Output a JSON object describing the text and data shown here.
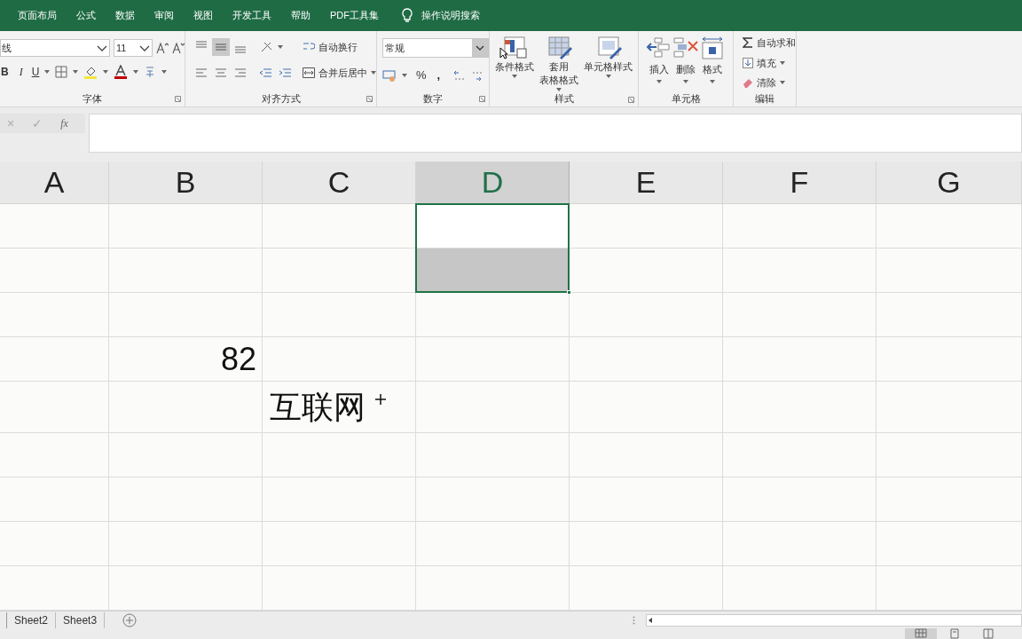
{
  "menu_tabs": [
    {
      "label": "页面布局",
      "selected": false
    },
    {
      "label": "公式",
      "selected": false
    },
    {
      "label": "数据",
      "selected": false
    },
    {
      "label": "审阅",
      "selected": false
    },
    {
      "label": "视图",
      "selected": false
    },
    {
      "label": "开发工具",
      "selected": false
    },
    {
      "label": "帮助",
      "selected": false
    },
    {
      "label": "PDF工具集",
      "selected": false
    }
  ],
  "tell_me": "操作说明搜索",
  "font_group": {
    "font_name": "线",
    "font_size": "11",
    "bold": "B",
    "italic": "I",
    "underline": "U",
    "label": "字体"
  },
  "align_group": {
    "wrap_text": "自动换行",
    "merge_center": "合并后居中",
    "label": "对齐方式"
  },
  "number_group": {
    "format": "常规",
    "percent": "%",
    "comma": ",",
    "label": "数字"
  },
  "styles_group": {
    "buttons": [
      {
        "lines": [
          "条件格式"
        ]
      },
      {
        "lines": [
          "套用",
          "表格格式"
        ]
      },
      {
        "lines": [
          "单元格样式"
        ]
      }
    ],
    "label": "样式"
  },
  "cells_group": {
    "buttons": [
      "插入",
      "删除",
      "格式"
    ],
    "label": "单元格"
  },
  "editing_group": {
    "autosum": "自动求和",
    "fill": "填充",
    "clear": "清除",
    "label": "编辑"
  },
  "formula_bar": {
    "cancel": "×",
    "enter": "✓",
    "fx": "fx"
  },
  "columns": [
    {
      "label": "A",
      "selected": false
    },
    {
      "label": "B",
      "selected": false
    },
    {
      "label": "C",
      "selected": false
    },
    {
      "label": "D",
      "selected": true
    },
    {
      "label": "E",
      "selected": false
    },
    {
      "label": "F",
      "selected": false
    },
    {
      "label": "G",
      "selected": false
    }
  ],
  "rows": [
    {
      "selected": true,
      "active": true
    },
    {
      "selected": true,
      "active": false
    },
    {
      "selected": false
    },
    {
      "selected": false,
      "B": "82"
    },
    {
      "selected": false,
      "C": "互联网"
    },
    {
      "selected": false
    },
    {
      "selected": false
    },
    {
      "selected": false
    },
    {
      "selected": false
    }
  ],
  "sheet_tabs": [
    {
      "label": "Sheet2",
      "selected": false
    },
    {
      "label": "Sheet3",
      "selected": false
    }
  ],
  "view_buttons": [
    {
      "selected": true
    },
    {
      "selected": false
    },
    {
      "selected": false
    }
  ]
}
